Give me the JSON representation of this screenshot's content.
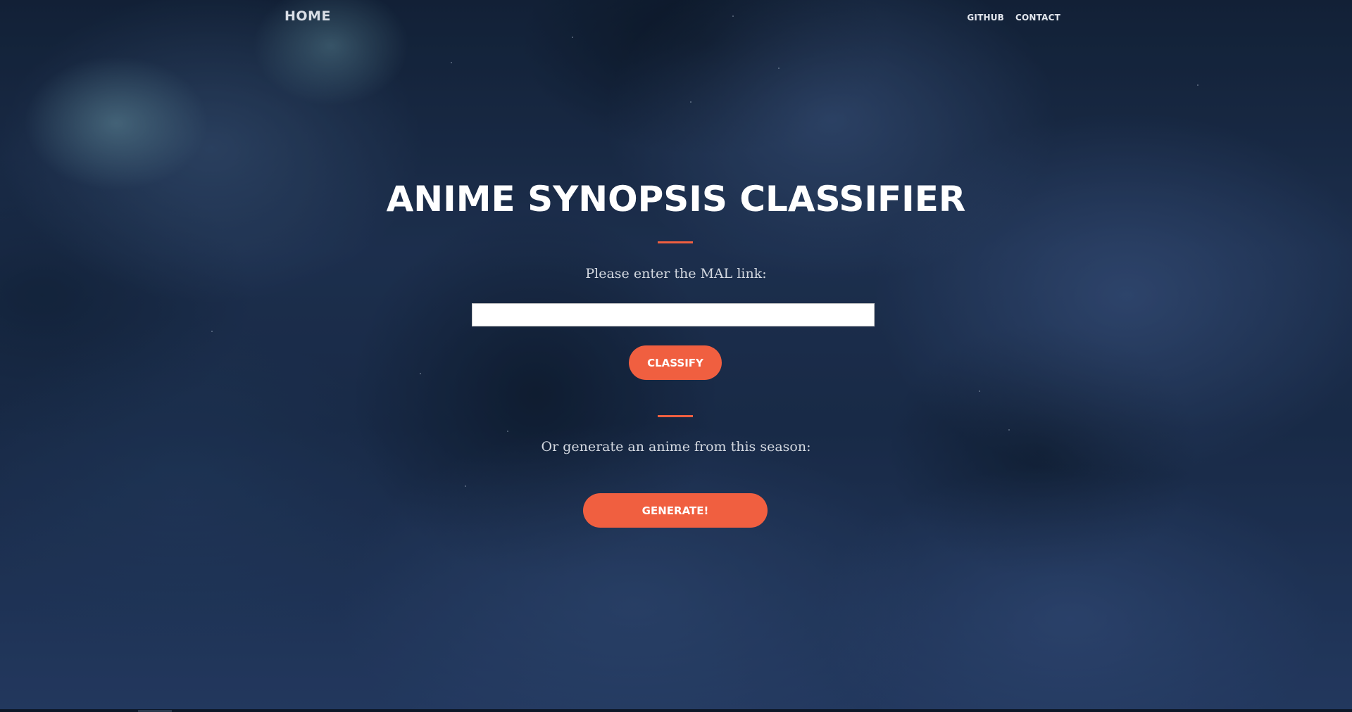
{
  "nav": {
    "home_label": "HOME",
    "links": [
      {
        "label": "GITHUB"
      },
      {
        "label": "CONTACT"
      }
    ]
  },
  "hero": {
    "title": "ANIME SYNOPSIS CLASSIFIER",
    "mal_prompt": "Please enter the MAL link:",
    "mal_input_value": "",
    "classify_label": "CLASSIFY",
    "generate_prompt": "Or generate an anime from this season:",
    "generate_label": "GENERATE!"
  },
  "colors": {
    "accent": "#f05f40",
    "background": "#1f3250",
    "title_text": "#ffffff",
    "prompt_text": "#d3d8e0"
  },
  "icons": {
    "background": "night-sky-clouds-image"
  }
}
